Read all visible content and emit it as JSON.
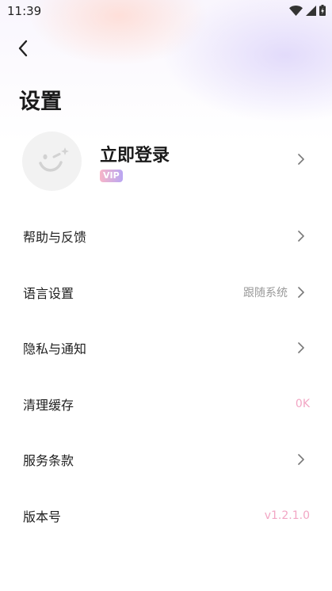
{
  "status_bar": {
    "time": "11:39"
  },
  "header": {
    "title": "设置"
  },
  "profile": {
    "login_label": "立即登录",
    "badge": "VIP"
  },
  "menu": {
    "items": [
      {
        "label": "帮助与反馈",
        "value": "",
        "has_chevron": true
      },
      {
        "label": "语言设置",
        "value": "跟随系统",
        "has_chevron": true
      },
      {
        "label": "隐私与通知",
        "value": "",
        "has_chevron": true
      },
      {
        "label": "清理缓存",
        "value": "0K",
        "has_chevron": false
      },
      {
        "label": "服务条款",
        "value": "",
        "has_chevron": true
      },
      {
        "label": "版本号",
        "value": "v1.2.1.0",
        "has_chevron": false
      }
    ]
  },
  "colors": {
    "accent_pink": "#f2a6c4",
    "muted_text": "#999999",
    "vip_gradient": [
      "#f7b5c8",
      "#b9a6f2"
    ]
  }
}
